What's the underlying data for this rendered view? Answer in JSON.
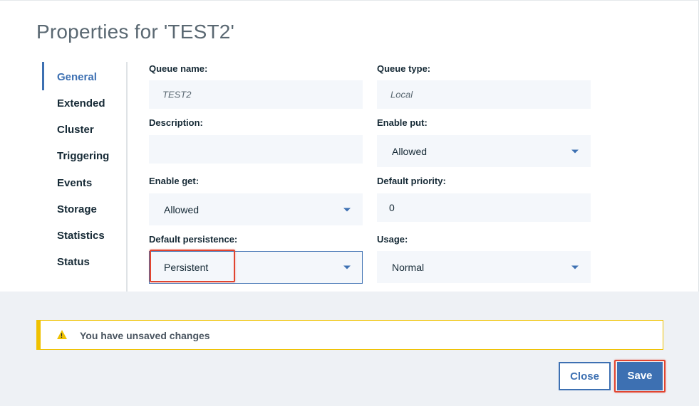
{
  "dialog": {
    "title": "Properties for 'TEST2'"
  },
  "nav": {
    "items": [
      {
        "label": "General",
        "active": true
      },
      {
        "label": "Extended"
      },
      {
        "label": "Cluster"
      },
      {
        "label": "Triggering"
      },
      {
        "label": "Events"
      },
      {
        "label": "Storage"
      },
      {
        "label": "Statistics"
      },
      {
        "label": "Status"
      }
    ]
  },
  "fields": {
    "queue_name": {
      "label": "Queue name:",
      "value": "TEST2"
    },
    "queue_type": {
      "label": "Queue type:",
      "value": "Local"
    },
    "description": {
      "label": "Description:",
      "value": ""
    },
    "enable_put": {
      "label": "Enable put:",
      "value": "Allowed"
    },
    "enable_get": {
      "label": "Enable get:",
      "value": "Allowed"
    },
    "default_priority": {
      "label": "Default priority:",
      "value": "0"
    },
    "default_persistence": {
      "label": "Default persistence:",
      "value": "Persistent"
    },
    "usage": {
      "label": "Usage:",
      "value": "Normal"
    }
  },
  "warning": {
    "icon": "warning-triangle-icon",
    "text": "You have unsaved changes"
  },
  "buttons": {
    "close": "Close",
    "save": "Save"
  },
  "colors": {
    "accent": "#3d70b2",
    "warning": "#efc100",
    "highlight": "#e1442f"
  }
}
